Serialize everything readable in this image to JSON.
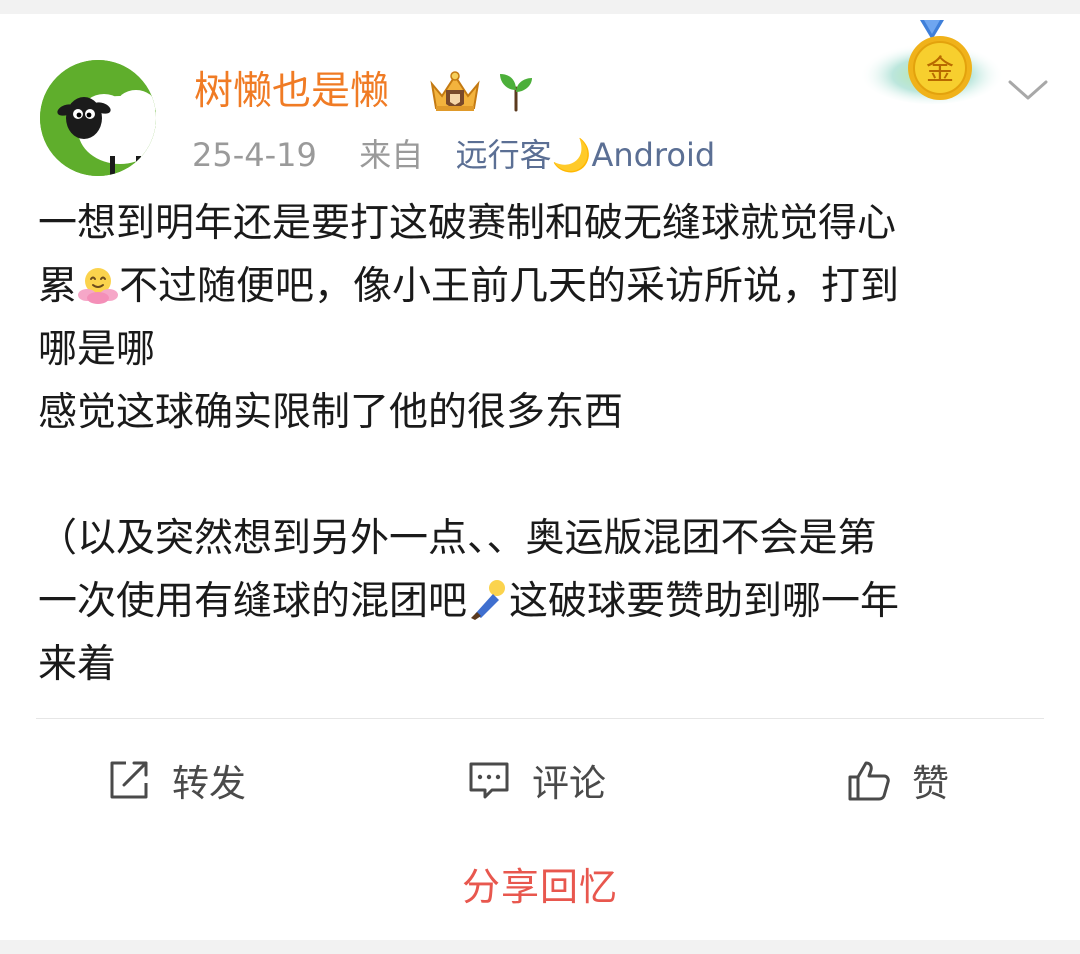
{
  "post": {
    "username": "树懒也是懒",
    "date": "25-4-19",
    "from_label": "来自",
    "source": "远行客🌙Android",
    "content": {
      "line1": "一想到明年还是要打这破赛制和破无缝球就觉得心",
      "line2_start": "累",
      "line2_rest": "不过随便吧，像小王前几天的采访所说，打到",
      "line3": "哪是哪",
      "line4": "感觉这球确实限制了他的很多东西",
      "line5": "（以及突然想到另外一点、、奥运版混团不会是第",
      "line6_start": "一次使用有缝球的混团吧",
      "line6_rest": "这破球要赞助到哪一年",
      "line7": "来着"
    },
    "icons": {
      "avatar": "sheep-avatar",
      "badges": [
        "crown-badge-icon",
        "sprout-icon"
      ],
      "medal": "gold-medal-icon",
      "emoji1": "blossom-emoji",
      "emoji2": "lying-man-emoji"
    }
  },
  "actions": {
    "repost": "转发",
    "comment": "评论",
    "like": "赞"
  },
  "footer": {
    "share_memory": "分享回忆"
  },
  "colors": {
    "username": "#f07b24",
    "source": "#5b6f94",
    "share": "#e8574e"
  }
}
